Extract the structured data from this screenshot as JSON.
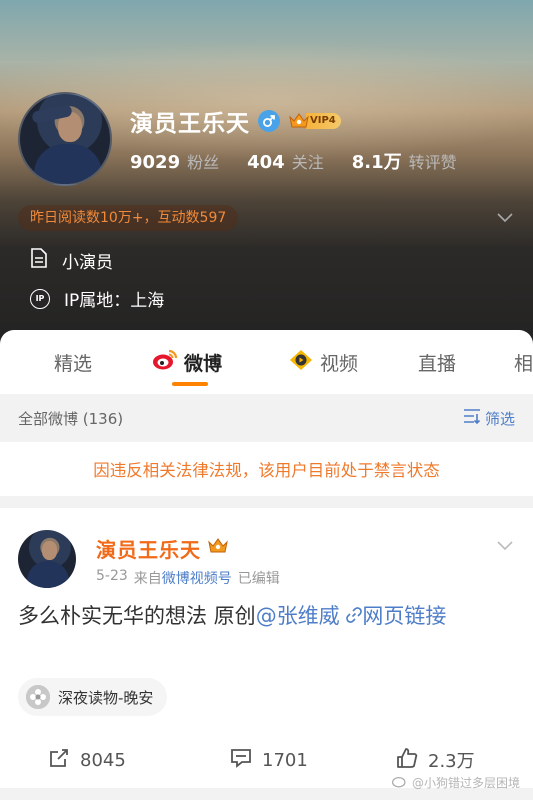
{
  "profile": {
    "name": "演员王乐天",
    "vip_label": "VIP4",
    "stats": [
      {
        "num": "9029",
        "label": "粉丝"
      },
      {
        "num": "404",
        "label": "关注"
      },
      {
        "num": "8.1万",
        "label": "转评赞"
      }
    ],
    "read_pill": "昨日阅读数10万+，互动数597",
    "bio": "小演员",
    "ip_icon": "IP",
    "ip_location": "IP属地：上海"
  },
  "tabs": [
    {
      "label": "精选",
      "icon": "none"
    },
    {
      "label": "微博",
      "icon": "weibo-icon"
    },
    {
      "label": "视频",
      "icon": "video-icon"
    },
    {
      "label": "直播",
      "icon": "none"
    },
    {
      "label": "相",
      "icon": "none"
    }
  ],
  "filter": {
    "all_posts": "全部微博 (136)",
    "filter_label": "筛选"
  },
  "notice": "因违反相关法律法规，该用户目前处于禁言状态",
  "post": {
    "author": "演员王乐天",
    "date": "5-23",
    "source_prefix": "来自",
    "source": "微博视频号",
    "edited": "已编辑",
    "text_main": "多么朴实无华的想法 原创",
    "mention": "@张维威",
    "link_text": "网页链接",
    "topic": "深夜读物-晚安",
    "repost_count": "8045",
    "comment_count": "1701",
    "like_count": "2.3万"
  },
  "watermark": "@小狗错过多层困境",
  "colors": {
    "accent_orange": "#ff8200",
    "link_blue": "#4e7ec8",
    "notice_orange": "#f07a2c"
  }
}
